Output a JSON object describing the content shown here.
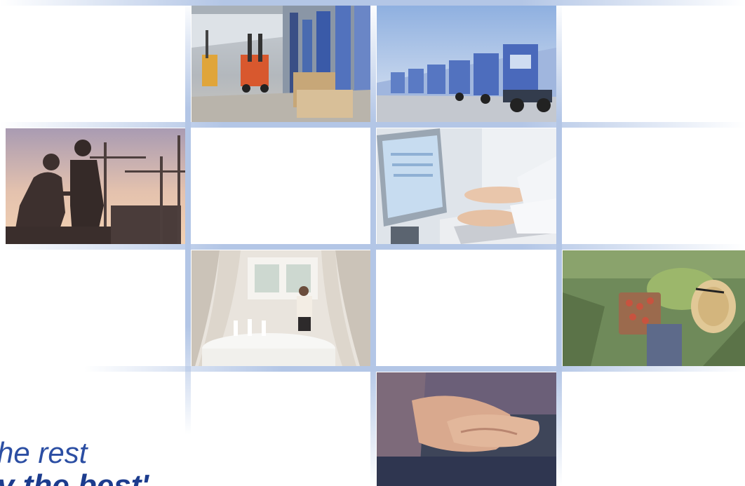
{
  "tagline": {
    "line1": "he rest",
    "line2": "y the best'"
  },
  "photos": {
    "warehouse": "warehouse-forklift-photo",
    "trucks": "truck-fleet-photo",
    "construction": "construction-workers-silhouette-photo",
    "office": "office-computer-typing-photo",
    "catering": "banquet-hall-waitress-photo",
    "farming": "strawberry-picker-photo",
    "care": "caring-hands-photo"
  },
  "colors": {
    "grid_line": "#b3c6e6",
    "tagline_regular": "#2b4ea3",
    "tagline_bold": "#1c3c8e"
  }
}
